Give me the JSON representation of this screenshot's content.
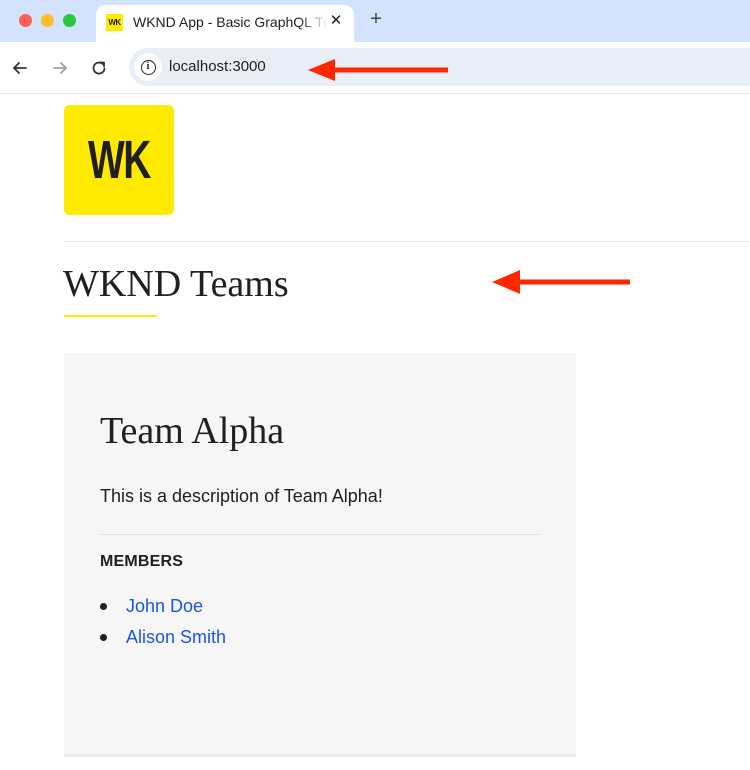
{
  "browser": {
    "tab": {
      "favicon_text": "WK",
      "title": "WKND App - Basic GraphQL Tutorial",
      "close_icon": "close-icon"
    },
    "new_tab_icon": "plus-icon",
    "nav": {
      "back_icon": "arrow-left-icon",
      "forward_icon": "arrow-right-icon",
      "reload_icon": "reload-icon"
    },
    "address_bar": {
      "site_info_icon": "info-icon",
      "url": "localhost:3000"
    }
  },
  "annotations": {
    "arrow_color": "#ff2600",
    "arrows": [
      "points-to-address-bar",
      "points-to-page-title"
    ]
  },
  "page": {
    "logo_text": "WK",
    "brand_color": "#ffea00",
    "title": "WKND Teams",
    "teams": [
      {
        "name": "Team Alpha",
        "description": "This is a description of Team Alpha!",
        "members_label": "MEMBERS",
        "members": [
          {
            "name": "John Doe"
          },
          {
            "name": "Alison Smith"
          }
        ]
      }
    ],
    "link_color": "#1a55e3"
  }
}
